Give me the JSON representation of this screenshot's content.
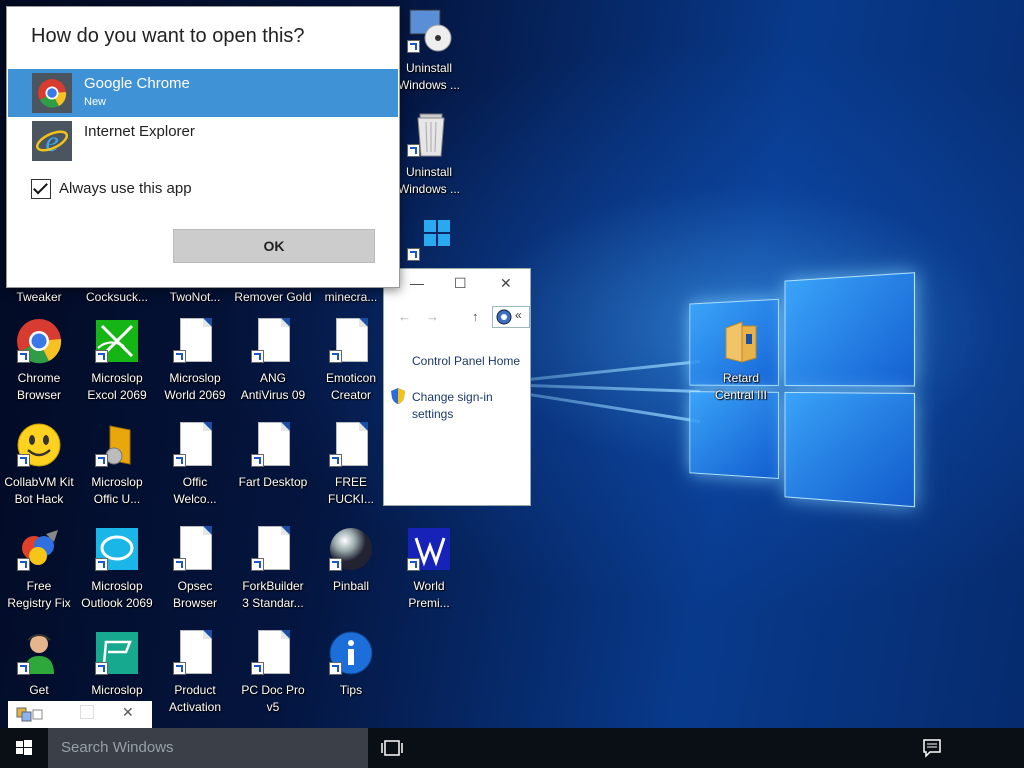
{
  "dialog": {
    "title": "How do you want to open this?",
    "apps": [
      {
        "name": "Google Chrome",
        "sub": "New",
        "icon": "chrome-icon",
        "selected": true
      },
      {
        "name": "Internet Explorer",
        "sub": "",
        "icon": "ie-icon",
        "selected": false
      }
    ],
    "always_label": "Always use this app",
    "always_checked": true,
    "ok_label": "OK"
  },
  "control_panel": {
    "home_link": "Control Panel Home",
    "signin_line1": "Change sign-in",
    "signin_line2": "settings",
    "minimize_glyph": "—",
    "maximize_glyph": "☐",
    "close_glyph": "✕",
    "nav_back": "←",
    "nav_forward": "→",
    "nav_up": "↑",
    "addr_chevron": "«"
  },
  "desktop": {
    "partial_labels": [
      "Tweaker",
      "Cocksuck...",
      "TwoNot...",
      "Remover Gold",
      "minecra..."
    ],
    "icons": [
      {
        "l1": "Uninstall",
        "l2": "Windows ...",
        "icon": "uninstall-disc-icon"
      },
      {
        "l1": "Uninstall",
        "l2": "Windows ...",
        "icon": "trash-can-icon"
      },
      {
        "l1": "",
        "l2": "",
        "icon": "windows-logo-icon"
      },
      {
        "l1": "Chrome",
        "l2": "Browser",
        "icon": "chrome-icon"
      },
      {
        "l1": "Microslop",
        "l2": "Excol 2069",
        "icon": "excel-icon"
      },
      {
        "l1": "Microslop",
        "l2": "World 2069",
        "icon": "document-icon"
      },
      {
        "l1": "ANG",
        "l2": "AntiVirus 09",
        "icon": "document-icon"
      },
      {
        "l1": "Emoticon",
        "l2": "Creator",
        "icon": "document-icon"
      },
      {
        "l1": "CollabVM Kit",
        "l2": "Bot Hack",
        "icon": "smiley-icon"
      },
      {
        "l1": "Microslop",
        "l2": "Offic U...",
        "icon": "office-icon"
      },
      {
        "l1": "Offic",
        "l2": "Welco...",
        "icon": "document-icon"
      },
      {
        "l1": "Fart Desktop",
        "l2": "",
        "icon": "document-icon"
      },
      {
        "l1": "FREE",
        "l2": "FUCKI...",
        "icon": "document-icon"
      },
      {
        "l1": "Free",
        "l2": "Registry Fix",
        "icon": "registry-icon"
      },
      {
        "l1": "Microslop",
        "l2": "Outlook 2069",
        "icon": "outlook-icon"
      },
      {
        "l1": "Opsec",
        "l2": "Browser",
        "icon": "document-icon"
      },
      {
        "l1": "ForkBuilder",
        "l2": "3 Standar...",
        "icon": "document-icon"
      },
      {
        "l1": "Pinball",
        "l2": "",
        "icon": "pinball-icon"
      },
      {
        "l1": "World",
        "l2": "Premi...",
        "icon": "world-premiere-icon"
      },
      {
        "l1": "Get",
        "l2": "",
        "icon": "get-help-icon"
      },
      {
        "l1": "Microslop",
        "l2": "",
        "icon": "publisher-icon"
      },
      {
        "l1": "Product",
        "l2": "Activation",
        "icon": "document-icon"
      },
      {
        "l1": "PC Doc Pro",
        "l2": "v5",
        "icon": "document-icon"
      },
      {
        "l1": "Tips",
        "l2": "",
        "icon": "info-icon"
      },
      {
        "l1": "Retard",
        "l2": "Central III",
        "icon": "folder-icon"
      }
    ]
  },
  "mini_window": {
    "close_glyph": "✕"
  },
  "taskbar": {
    "search_placeholder": "Search Windows"
  },
  "colors": {
    "selected_row": "#3f92d6",
    "taskbar": "#0a0f16",
    "search_box": "#3a3f48"
  }
}
